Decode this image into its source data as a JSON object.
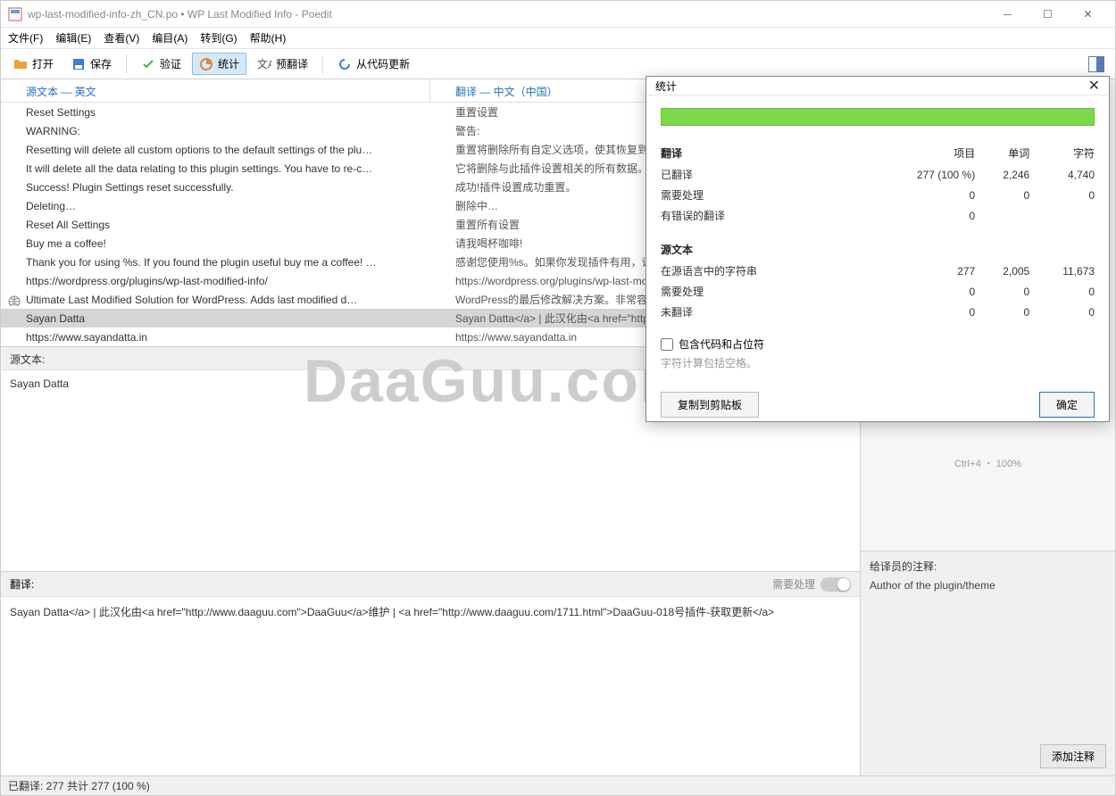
{
  "window": {
    "title": "wp-last-modified-info-zh_CN.po • WP Last Modified Info - Poedit"
  },
  "menubar": {
    "file": "文件(F)",
    "edit": "编辑(E)",
    "view": "查看(V)",
    "entry": "编目(A)",
    "goto": "转到(G)",
    "help": "帮助(H)"
  },
  "toolbar": {
    "open": "打开",
    "save": "保存",
    "verify": "验证",
    "stats": "统计",
    "pretranslate": "预翻译",
    "fromcode": "从代码更新"
  },
  "headers": {
    "source": "源文本 — 英文",
    "target": "翻译 — 中文（中国）"
  },
  "rows": [
    {
      "src": "Reset Settings",
      "tgt": "重置设置"
    },
    {
      "src": "WARNING:",
      "tgt": "警告:"
    },
    {
      "src": "Resetting will delete all custom options to the default settings of the plu…",
      "tgt": "重置将删除所有自定义选项，使其恢复到数据库中…"
    },
    {
      "src": "It will delete all the data relating to this plugin settings. You have to re-c…",
      "tgt": "它将删除与此插件设置相关的所有数据。你必须重…"
    },
    {
      "src": "Success! Plugin Settings reset successfully.",
      "tgt": "成功!插件设置成功重置。"
    },
    {
      "src": "Deleting…",
      "tgt": "删除中…"
    },
    {
      "src": "Reset All Settings",
      "tgt": "重置所有设置"
    },
    {
      "src": "Buy me a coffee!",
      "tgt": "请我喝杯咖啡!"
    },
    {
      "src": "Thank you for using %s. If you found the plugin useful buy me a coffee! …",
      "tgt": "感谢您使用%s。如果你发现插件有用，请给我买…"
    },
    {
      "src": "https://wordpress.org/plugins/wp-last-modified-info/",
      "tgt": "https://wordpress.org/plugins/wp-last-modi…"
    },
    {
      "src": "Ultimate Last Modified Solution for WordPress. Adds last modified d…",
      "tgt": "WordPress的最后修改解决方案。非常容易地…",
      "icon": true
    },
    {
      "src": "Sayan Datta",
      "tgt": "Sayan Datta</a> | 此汉化由<a href=\"http://…",
      "selected": true
    },
    {
      "src": "https://www.sayandatta.in",
      "tgt": "https://www.sayandatta.in"
    }
  ],
  "src_panel": {
    "label": "源文本:",
    "text": "Sayan Datta"
  },
  "trans_panel": {
    "label": "翻译:",
    "needs_work": "需要处理",
    "text": "Sayan Datta</a> | 此汉化由<a href=\"http://www.daaguu.com\">DaaGuu</a>维护 | <a href=\"http://www.daaguu.com/1711.html\">DaaGuu-018号插件-获取更新</a>"
  },
  "statusbar": {
    "text": "已翻译: 277 共计 277 (100 %)"
  },
  "right": {
    "zoom": "Ctrl+4 ・ 100%",
    "notes_label": "给译员的注释:",
    "notes_text": "Author of the plugin/theme",
    "add_note": "添加注释"
  },
  "stats": {
    "title": "统计",
    "section1": "翻译",
    "col_items": "项目",
    "col_words": "单词",
    "col_chars": "字符",
    "r_translated": "已翻译",
    "r_translated_v": [
      "277 (100 %)",
      "2,246",
      "4,740"
    ],
    "r_needswork": "需要处理",
    "r_needswork_v": [
      "0",
      "0",
      "0"
    ],
    "r_errors": "有错误的翻译",
    "r_errors_v": [
      "0",
      "",
      ""
    ],
    "section2": "源文本",
    "r_srclang": "在源语言中的字符串",
    "r_srclang_v": [
      "277",
      "2,005",
      "11,673"
    ],
    "r_srcneeds": "需要处理",
    "r_srcneeds_v": [
      "0",
      "0",
      "0"
    ],
    "r_untrans": "未翻译",
    "r_untrans_v": [
      "0",
      "0",
      "0"
    ],
    "check_label": "包含代码和占位符",
    "hint": "字符计算包括空格。",
    "copy_btn": "复制到剪贴板",
    "ok_btn": "确定"
  },
  "watermark": "DaaGuu.com"
}
